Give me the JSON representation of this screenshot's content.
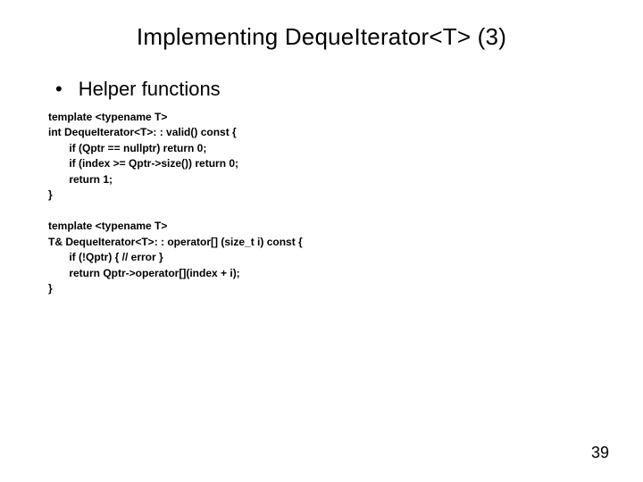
{
  "title": "Implementing DequeIterator<T> (3)",
  "bullet": "Helper functions",
  "code1": "template <typename T>\nint DequeIterator<T>: : valid() const {\n       if (Qptr == nullptr) return 0;\n       if (index >= Qptr->size()) return 0;\n       return 1;\n}",
  "code2": "template <typename T>\nT& DequeIterator<T>: : operator[] (size_t i) const {\n       if (!Qptr) { // error }\n       return Qptr->operator[](index + i);\n}",
  "page_number": "39"
}
